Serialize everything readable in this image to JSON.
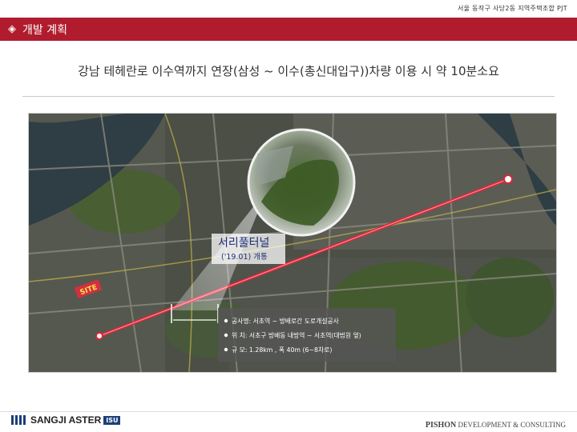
{
  "header": {
    "project": "서울 동작구 사당2동 지역주택조합 PJT",
    "section_title": "개발 계획",
    "diamond": "◈"
  },
  "headline": "강남 테헤란로 이수역까지 연장(삼성 ~ 이수(총신대입구))차량 이용 시 약 10분소요",
  "map": {
    "tunnel_name": "서리풀터널",
    "tunnel_open": "('19.01) 개통",
    "site_label": "SITE",
    "info": [
      "공사명: 서초역 ~ 방배로간 도로개설공사",
      "위  치: 서초구 방배동 내방역 ~ 서초역(대법원 옆)",
      "규  모: 1.28km , 폭 40m (6~8차로)"
    ],
    "colors": {
      "route": "#d8283a",
      "accent": "#b01c2e"
    }
  },
  "footer": {
    "company": "SANGJI ASTER",
    "company_badge": "ISU",
    "consult_brand": "PISHON",
    "consult_text": "DEVELOPMENT & CONSULTING"
  }
}
